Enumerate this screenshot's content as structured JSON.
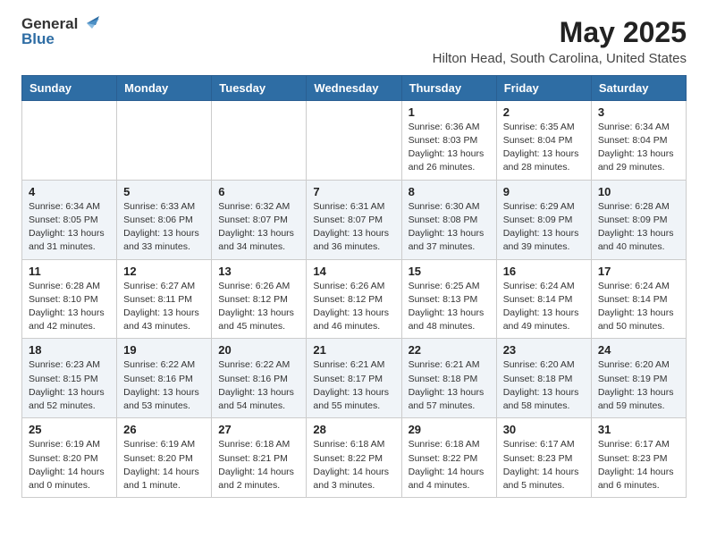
{
  "logo": {
    "general": "General",
    "blue": "Blue",
    "icon_color": "#2e6da4"
  },
  "header": {
    "title": "May 2025",
    "subtitle": "Hilton Head, South Carolina, United States"
  },
  "weekdays": [
    "Sunday",
    "Monday",
    "Tuesday",
    "Wednesday",
    "Thursday",
    "Friday",
    "Saturday"
  ],
  "weeks": [
    {
      "id": "week1",
      "cells": [
        {
          "day": "",
          "info": ""
        },
        {
          "day": "",
          "info": ""
        },
        {
          "day": "",
          "info": ""
        },
        {
          "day": "",
          "info": ""
        },
        {
          "day": "1",
          "info": "Sunrise: 6:36 AM\nSunset: 8:03 PM\nDaylight: 13 hours\nand 26 minutes."
        },
        {
          "day": "2",
          "info": "Sunrise: 6:35 AM\nSunset: 8:04 PM\nDaylight: 13 hours\nand 28 minutes."
        },
        {
          "day": "3",
          "info": "Sunrise: 6:34 AM\nSunset: 8:04 PM\nDaylight: 13 hours\nand 29 minutes."
        }
      ]
    },
    {
      "id": "week2",
      "cells": [
        {
          "day": "4",
          "info": "Sunrise: 6:34 AM\nSunset: 8:05 PM\nDaylight: 13 hours\nand 31 minutes."
        },
        {
          "day": "5",
          "info": "Sunrise: 6:33 AM\nSunset: 8:06 PM\nDaylight: 13 hours\nand 33 minutes."
        },
        {
          "day": "6",
          "info": "Sunrise: 6:32 AM\nSunset: 8:07 PM\nDaylight: 13 hours\nand 34 minutes."
        },
        {
          "day": "7",
          "info": "Sunrise: 6:31 AM\nSunset: 8:07 PM\nDaylight: 13 hours\nand 36 minutes."
        },
        {
          "day": "8",
          "info": "Sunrise: 6:30 AM\nSunset: 8:08 PM\nDaylight: 13 hours\nand 37 minutes."
        },
        {
          "day": "9",
          "info": "Sunrise: 6:29 AM\nSunset: 8:09 PM\nDaylight: 13 hours\nand 39 minutes."
        },
        {
          "day": "10",
          "info": "Sunrise: 6:28 AM\nSunset: 8:09 PM\nDaylight: 13 hours\nand 40 minutes."
        }
      ]
    },
    {
      "id": "week3",
      "cells": [
        {
          "day": "11",
          "info": "Sunrise: 6:28 AM\nSunset: 8:10 PM\nDaylight: 13 hours\nand 42 minutes."
        },
        {
          "day": "12",
          "info": "Sunrise: 6:27 AM\nSunset: 8:11 PM\nDaylight: 13 hours\nand 43 minutes."
        },
        {
          "day": "13",
          "info": "Sunrise: 6:26 AM\nSunset: 8:12 PM\nDaylight: 13 hours\nand 45 minutes."
        },
        {
          "day": "14",
          "info": "Sunrise: 6:26 AM\nSunset: 8:12 PM\nDaylight: 13 hours\nand 46 minutes."
        },
        {
          "day": "15",
          "info": "Sunrise: 6:25 AM\nSunset: 8:13 PM\nDaylight: 13 hours\nand 48 minutes."
        },
        {
          "day": "16",
          "info": "Sunrise: 6:24 AM\nSunset: 8:14 PM\nDaylight: 13 hours\nand 49 minutes."
        },
        {
          "day": "17",
          "info": "Sunrise: 6:24 AM\nSunset: 8:14 PM\nDaylight: 13 hours\nand 50 minutes."
        }
      ]
    },
    {
      "id": "week4",
      "cells": [
        {
          "day": "18",
          "info": "Sunrise: 6:23 AM\nSunset: 8:15 PM\nDaylight: 13 hours\nand 52 minutes."
        },
        {
          "day": "19",
          "info": "Sunrise: 6:22 AM\nSunset: 8:16 PM\nDaylight: 13 hours\nand 53 minutes."
        },
        {
          "day": "20",
          "info": "Sunrise: 6:22 AM\nSunset: 8:16 PM\nDaylight: 13 hours\nand 54 minutes."
        },
        {
          "day": "21",
          "info": "Sunrise: 6:21 AM\nSunset: 8:17 PM\nDaylight: 13 hours\nand 55 minutes."
        },
        {
          "day": "22",
          "info": "Sunrise: 6:21 AM\nSunset: 8:18 PM\nDaylight: 13 hours\nand 57 minutes."
        },
        {
          "day": "23",
          "info": "Sunrise: 6:20 AM\nSunset: 8:18 PM\nDaylight: 13 hours\nand 58 minutes."
        },
        {
          "day": "24",
          "info": "Sunrise: 6:20 AM\nSunset: 8:19 PM\nDaylight: 13 hours\nand 59 minutes."
        }
      ]
    },
    {
      "id": "week5",
      "cells": [
        {
          "day": "25",
          "info": "Sunrise: 6:19 AM\nSunset: 8:20 PM\nDaylight: 14 hours\nand 0 minutes."
        },
        {
          "day": "26",
          "info": "Sunrise: 6:19 AM\nSunset: 8:20 PM\nDaylight: 14 hours\nand 1 minute."
        },
        {
          "day": "27",
          "info": "Sunrise: 6:18 AM\nSunset: 8:21 PM\nDaylight: 14 hours\nand 2 minutes."
        },
        {
          "day": "28",
          "info": "Sunrise: 6:18 AM\nSunset: 8:22 PM\nDaylight: 14 hours\nand 3 minutes."
        },
        {
          "day": "29",
          "info": "Sunrise: 6:18 AM\nSunset: 8:22 PM\nDaylight: 14 hours\nand 4 minutes."
        },
        {
          "day": "30",
          "info": "Sunrise: 6:17 AM\nSunset: 8:23 PM\nDaylight: 14 hours\nand 5 minutes."
        },
        {
          "day": "31",
          "info": "Sunrise: 6:17 AM\nSunset: 8:23 PM\nDaylight: 14 hours\nand 6 minutes."
        }
      ]
    }
  ]
}
